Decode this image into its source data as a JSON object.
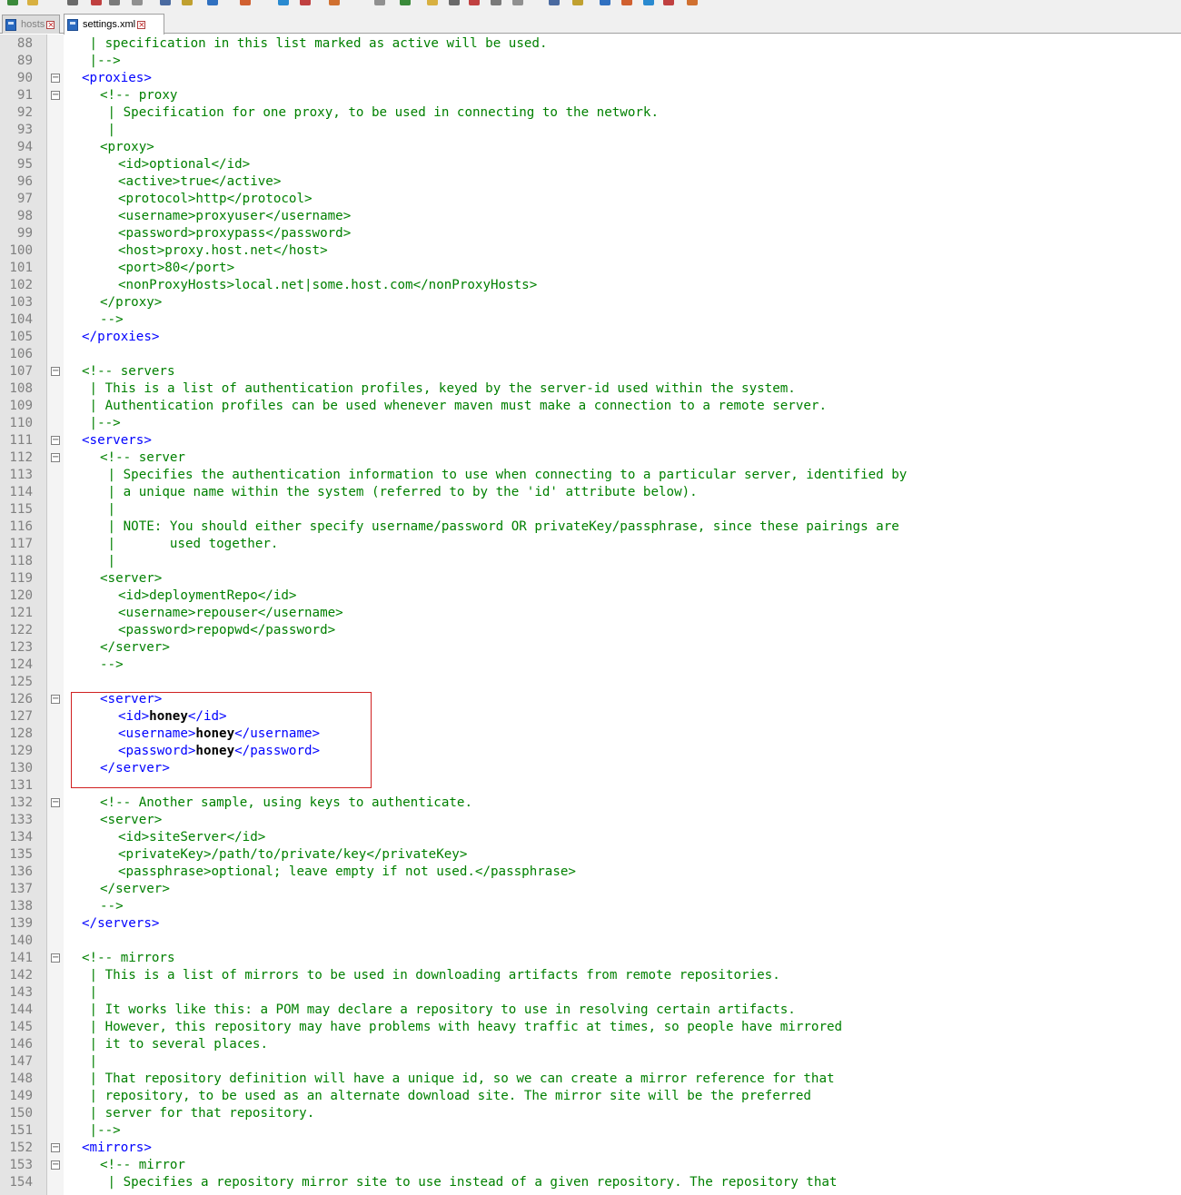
{
  "tabs": [
    {
      "label": "hosts",
      "active": false
    },
    {
      "label": "settings.xml",
      "active": true
    }
  ],
  "lines": [
    {
      "n": "88",
      "indent": 1,
      "text": " | specification in this list marked as active will be used."
    },
    {
      "n": "89",
      "indent": 1,
      "text": " |-->"
    },
    {
      "n": "90",
      "indent": 1,
      "text": "<proxies>",
      "style": "tag",
      "fold": "minus"
    },
    {
      "n": "91",
      "indent": 2,
      "text": "<!-- proxy",
      "fold": "minus"
    },
    {
      "n": "92",
      "indent": 2,
      "text": " | Specification for one proxy, to be used in connecting to the network."
    },
    {
      "n": "93",
      "indent": 2,
      "text": " |"
    },
    {
      "n": "94",
      "indent": 2,
      "text": "<proxy>"
    },
    {
      "n": "95",
      "indent": 3,
      "text": "<id>optional</id>"
    },
    {
      "n": "96",
      "indent": 3,
      "text": "<active>true</active>"
    },
    {
      "n": "97",
      "indent": 3,
      "text": "<protocol>http</protocol>"
    },
    {
      "n": "98",
      "indent": 3,
      "text": "<username>proxyuser</username>"
    },
    {
      "n": "99",
      "indent": 3,
      "text": "<password>proxypass</password>"
    },
    {
      "n": "100",
      "indent": 3,
      "text": "<host>proxy.host.net</host>"
    },
    {
      "n": "101",
      "indent": 3,
      "text": "<port>80</port>"
    },
    {
      "n": "102",
      "indent": 3,
      "text": "<nonProxyHosts>local.net|some.host.com</nonProxyHosts>"
    },
    {
      "n": "103",
      "indent": 2,
      "text": "</proxy>"
    },
    {
      "n": "104",
      "indent": 2,
      "text": "-->"
    },
    {
      "n": "105",
      "indent": 1,
      "text": "</proxies>",
      "style": "tag"
    },
    {
      "n": "106",
      "indent": 0,
      "text": ""
    },
    {
      "n": "107",
      "indent": 1,
      "text": "<!-- servers",
      "fold": "minus"
    },
    {
      "n": "108",
      "indent": 1,
      "text": " | This is a list of authentication profiles, keyed by the server-id used within the system."
    },
    {
      "n": "109",
      "indent": 1,
      "text": " | Authentication profiles can be used whenever maven must make a connection to a remote server."
    },
    {
      "n": "110",
      "indent": 1,
      "text": " |-->"
    },
    {
      "n": "111",
      "indent": 1,
      "text": "<servers>",
      "style": "tag",
      "fold": "minus"
    },
    {
      "n": "112",
      "indent": 2,
      "text": "<!-- server",
      "fold": "minus"
    },
    {
      "n": "113",
      "indent": 2,
      "text": " | Specifies the authentication information to use when connecting to a particular server, identified by"
    },
    {
      "n": "114",
      "indent": 2,
      "text": " | a unique name within the system (referred to by the 'id' attribute below)."
    },
    {
      "n": "115",
      "indent": 2,
      "text": " |"
    },
    {
      "n": "116",
      "indent": 2,
      "text": " | NOTE: You should either specify username/password OR privateKey/passphrase, since these pairings are"
    },
    {
      "n": "117",
      "indent": 2,
      "text": " |       used together."
    },
    {
      "n": "118",
      "indent": 2,
      "text": " |"
    },
    {
      "n": "119",
      "indent": 2,
      "text": "<server>"
    },
    {
      "n": "120",
      "indent": 3,
      "text": "<id>deploymentRepo</id>"
    },
    {
      "n": "121",
      "indent": 3,
      "text": "<username>repouser</username>"
    },
    {
      "n": "122",
      "indent": 3,
      "text": "<password>repopwd</password>"
    },
    {
      "n": "123",
      "indent": 2,
      "text": "</server>"
    },
    {
      "n": "124",
      "indent": 2,
      "text": "-->"
    },
    {
      "n": "125",
      "indent": 0,
      "text": ""
    },
    {
      "n": "126",
      "indent": 2,
      "text": "<server>",
      "style": "tag",
      "fold": "minus"
    },
    {
      "n": "127",
      "indent": 3,
      "text": "<id>",
      "style": "tag",
      "value": "honey",
      "close": "</id>"
    },
    {
      "n": "128",
      "indent": 3,
      "text": "<username>",
      "style": "tag",
      "value": "honey",
      "close": "</username>"
    },
    {
      "n": "129",
      "indent": 3,
      "text": "<password>",
      "style": "tag",
      "value": "honey",
      "close": "</password>"
    },
    {
      "n": "130",
      "indent": 2,
      "text": "</server>",
      "style": "tag"
    },
    {
      "n": "131",
      "indent": 0,
      "text": ""
    },
    {
      "n": "132",
      "indent": 2,
      "text": "<!-- Another sample, using keys to authenticate.",
      "fold": "minus"
    },
    {
      "n": "133",
      "indent": 2,
      "text": "<server>"
    },
    {
      "n": "134",
      "indent": 3,
      "text": "<id>siteServer</id>"
    },
    {
      "n": "135",
      "indent": 3,
      "text": "<privateKey>/path/to/private/key</privateKey>"
    },
    {
      "n": "136",
      "indent": 3,
      "text": "<passphrase>optional; leave empty if not used.</passphrase>"
    },
    {
      "n": "137",
      "indent": 2,
      "text": "</server>"
    },
    {
      "n": "138",
      "indent": 2,
      "text": "-->"
    },
    {
      "n": "139",
      "indent": 1,
      "text": "</servers>",
      "style": "tag"
    },
    {
      "n": "140",
      "indent": 0,
      "text": ""
    },
    {
      "n": "141",
      "indent": 1,
      "text": "<!-- mirrors",
      "fold": "minus"
    },
    {
      "n": "142",
      "indent": 1,
      "text": " | This is a list of mirrors to be used in downloading artifacts from remote repositories."
    },
    {
      "n": "143",
      "indent": 1,
      "text": " |"
    },
    {
      "n": "144",
      "indent": 1,
      "text": " | It works like this: a POM may declare a repository to use in resolving certain artifacts."
    },
    {
      "n": "145",
      "indent": 1,
      "text": " | However, this repository may have problems with heavy traffic at times, so people have mirrored"
    },
    {
      "n": "146",
      "indent": 1,
      "text": " | it to several places."
    },
    {
      "n": "147",
      "indent": 1,
      "text": " |"
    },
    {
      "n": "148",
      "indent": 1,
      "text": " | That repository definition will have a unique id, so we can create a mirror reference for that"
    },
    {
      "n": "149",
      "indent": 1,
      "text": " | repository, to be used as an alternate download site. The mirror site will be the preferred"
    },
    {
      "n": "150",
      "indent": 1,
      "text": " | server for that repository."
    },
    {
      "n": "151",
      "indent": 1,
      "text": " |-->"
    },
    {
      "n": "152",
      "indent": 1,
      "text": "<mirrors>",
      "style": "tag",
      "fold": "minus"
    },
    {
      "n": "153",
      "indent": 2,
      "text": "<!-- mirror",
      "fold": "minus"
    },
    {
      "n": "154",
      "indent": 2,
      "text": " | Specifies a repository mirror site to use instead of a given repository. The repository that"
    }
  ]
}
